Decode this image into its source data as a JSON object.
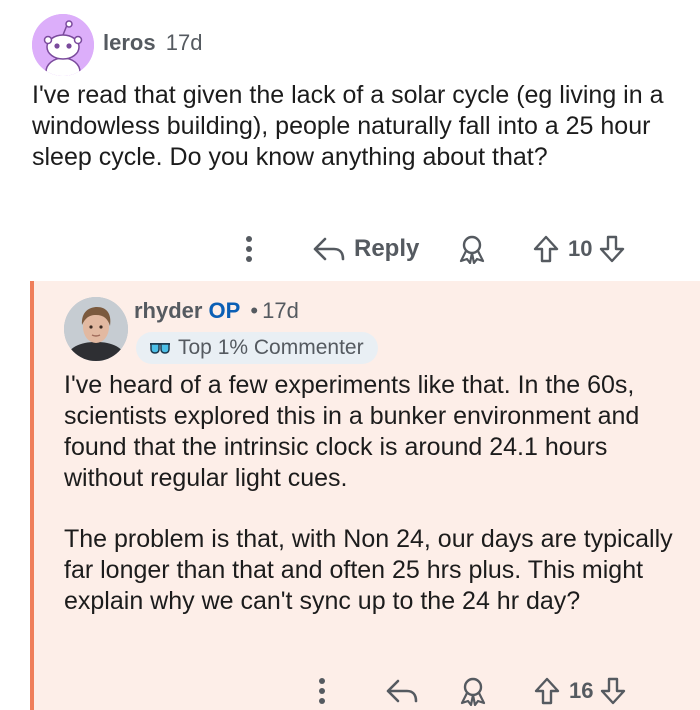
{
  "comment1": {
    "username": "leros",
    "time": "17d",
    "body": "I've read that given the lack of a solar cycle (eg living in a windowless building), people naturally fall into a 25 hour sleep cycle. Do you know anything about that?",
    "actions": {
      "more_icon": "more-vertical-icon",
      "reply_label": "Reply",
      "award_icon": "award-icon",
      "upvote_icon": "upvote-arrow-icon",
      "vote_count": "10",
      "downvote_icon": "downvote-arrow-icon"
    }
  },
  "comment2": {
    "username": "rhyder",
    "op_label": "OP",
    "separator": "•",
    "time": "17d",
    "badge": {
      "icon": "sunglasses-icon",
      "label": "Top 1% Commenter"
    },
    "paragraphs": [
      "I've heard of a few experiments like that. In the 60s, scientists explored this in a bunker environment and found that the intrinsic clock is around 24.1 hours without regular light cues.",
      "The problem is that, with Non 24, our days are typically far longer than that and often 25 hrs plus. This might explain why we can't sync up to the 24 hr day?"
    ],
    "actions": {
      "more_icon": "more-vertical-icon",
      "reply_icon": "reply-arrow-icon",
      "award_icon": "award-icon",
      "upvote_icon": "upvote-arrow-icon",
      "vote_count": "16",
      "downvote_icon": "downvote-arrow-icon"
    }
  },
  "colors": {
    "accent_thread_line": "#ef7e5a",
    "reply_background": "#fdeee8",
    "op_blue": "#0b5fb5",
    "avatar1_bg": "#dcaefa"
  }
}
